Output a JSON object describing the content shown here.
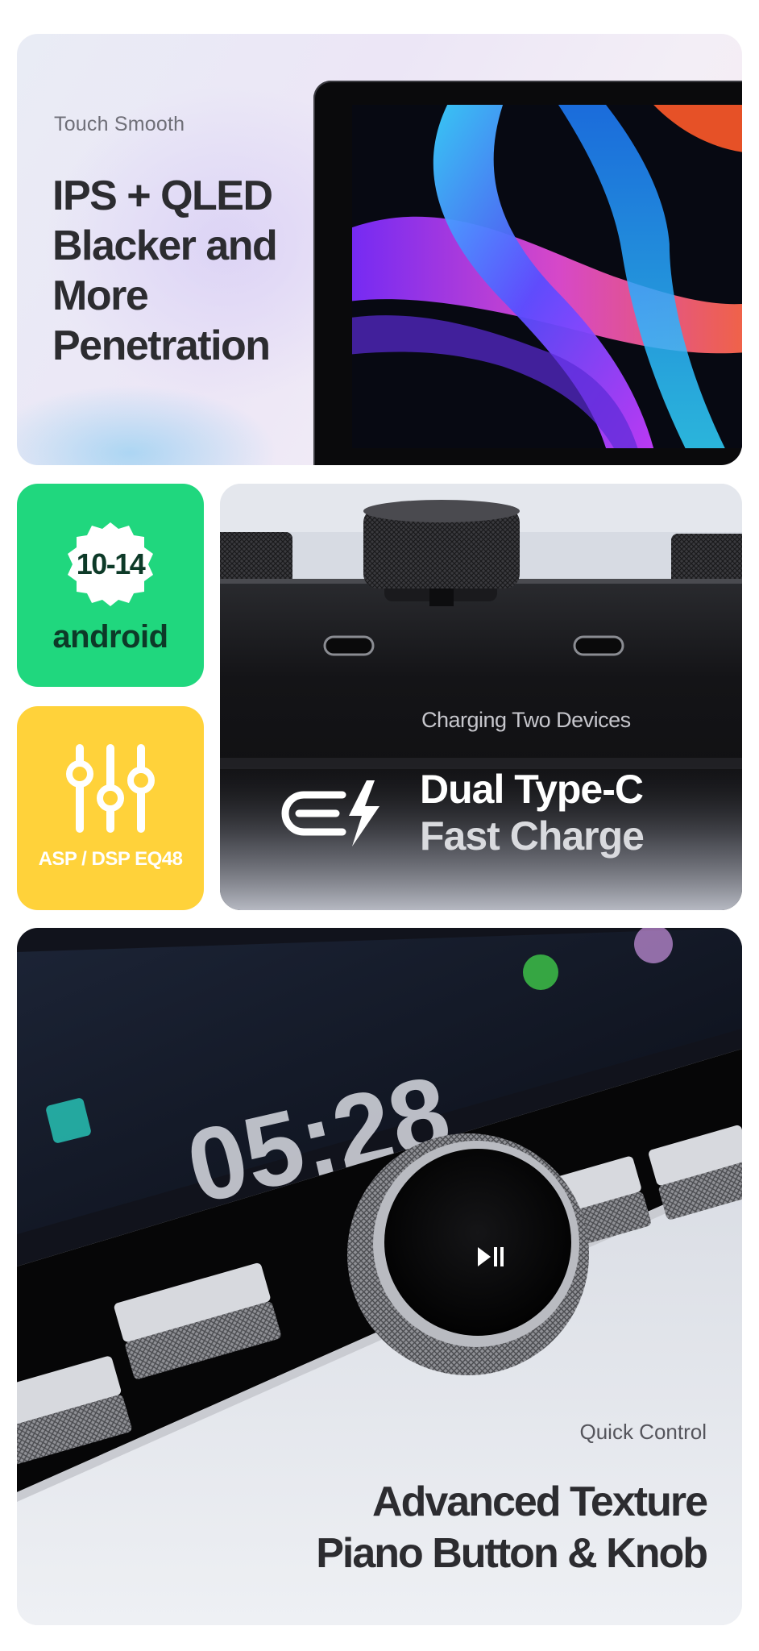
{
  "display_card": {
    "eyebrow": "Touch Smooth",
    "headline_lines": [
      "IPS + QLED",
      "Blacker and",
      "More",
      "Penetration"
    ]
  },
  "android_card": {
    "version_badge": "10-14",
    "label": "android",
    "accent_color": "#20d77e"
  },
  "dsp_card": {
    "label": "ASP / DSP EQ48",
    "icon": "equalizer-sliders-icon",
    "accent_color": "#ffd23a"
  },
  "typec_card": {
    "eyebrow": "Charging Two Devices",
    "headline_line1": "Dual Type-C",
    "headline_line2": "Fast Charge",
    "icon": "usb-fast-charge-icon"
  },
  "control_card": {
    "clock": "05:28",
    "eyebrow": "Quick Control",
    "headline_lines": [
      "Advanced Texture",
      "Piano Button & Knob"
    ],
    "knob_icon": "play-pause-icon"
  }
}
